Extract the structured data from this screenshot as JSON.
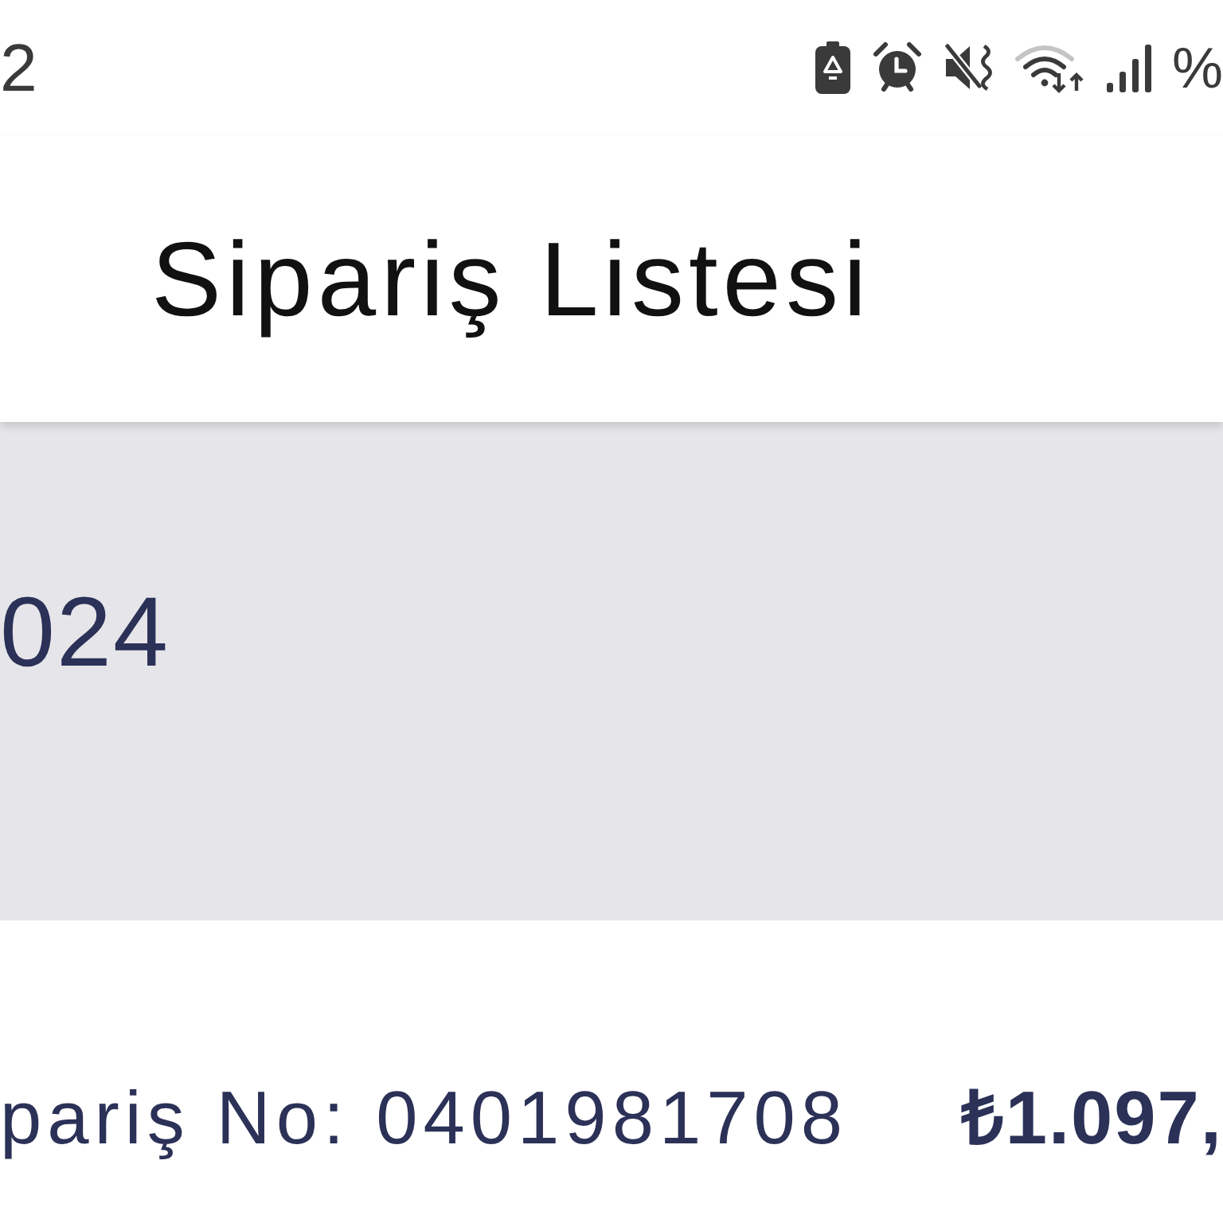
{
  "status_bar": {
    "time": "2",
    "battery": "%"
  },
  "app_bar": {
    "title": "Sipariş Listesi"
  },
  "date_header": {
    "date": "024"
  },
  "orders": [
    {
      "order_no": "pariş No: 0401981708",
      "total": "₺1.097,"
    }
  ]
}
